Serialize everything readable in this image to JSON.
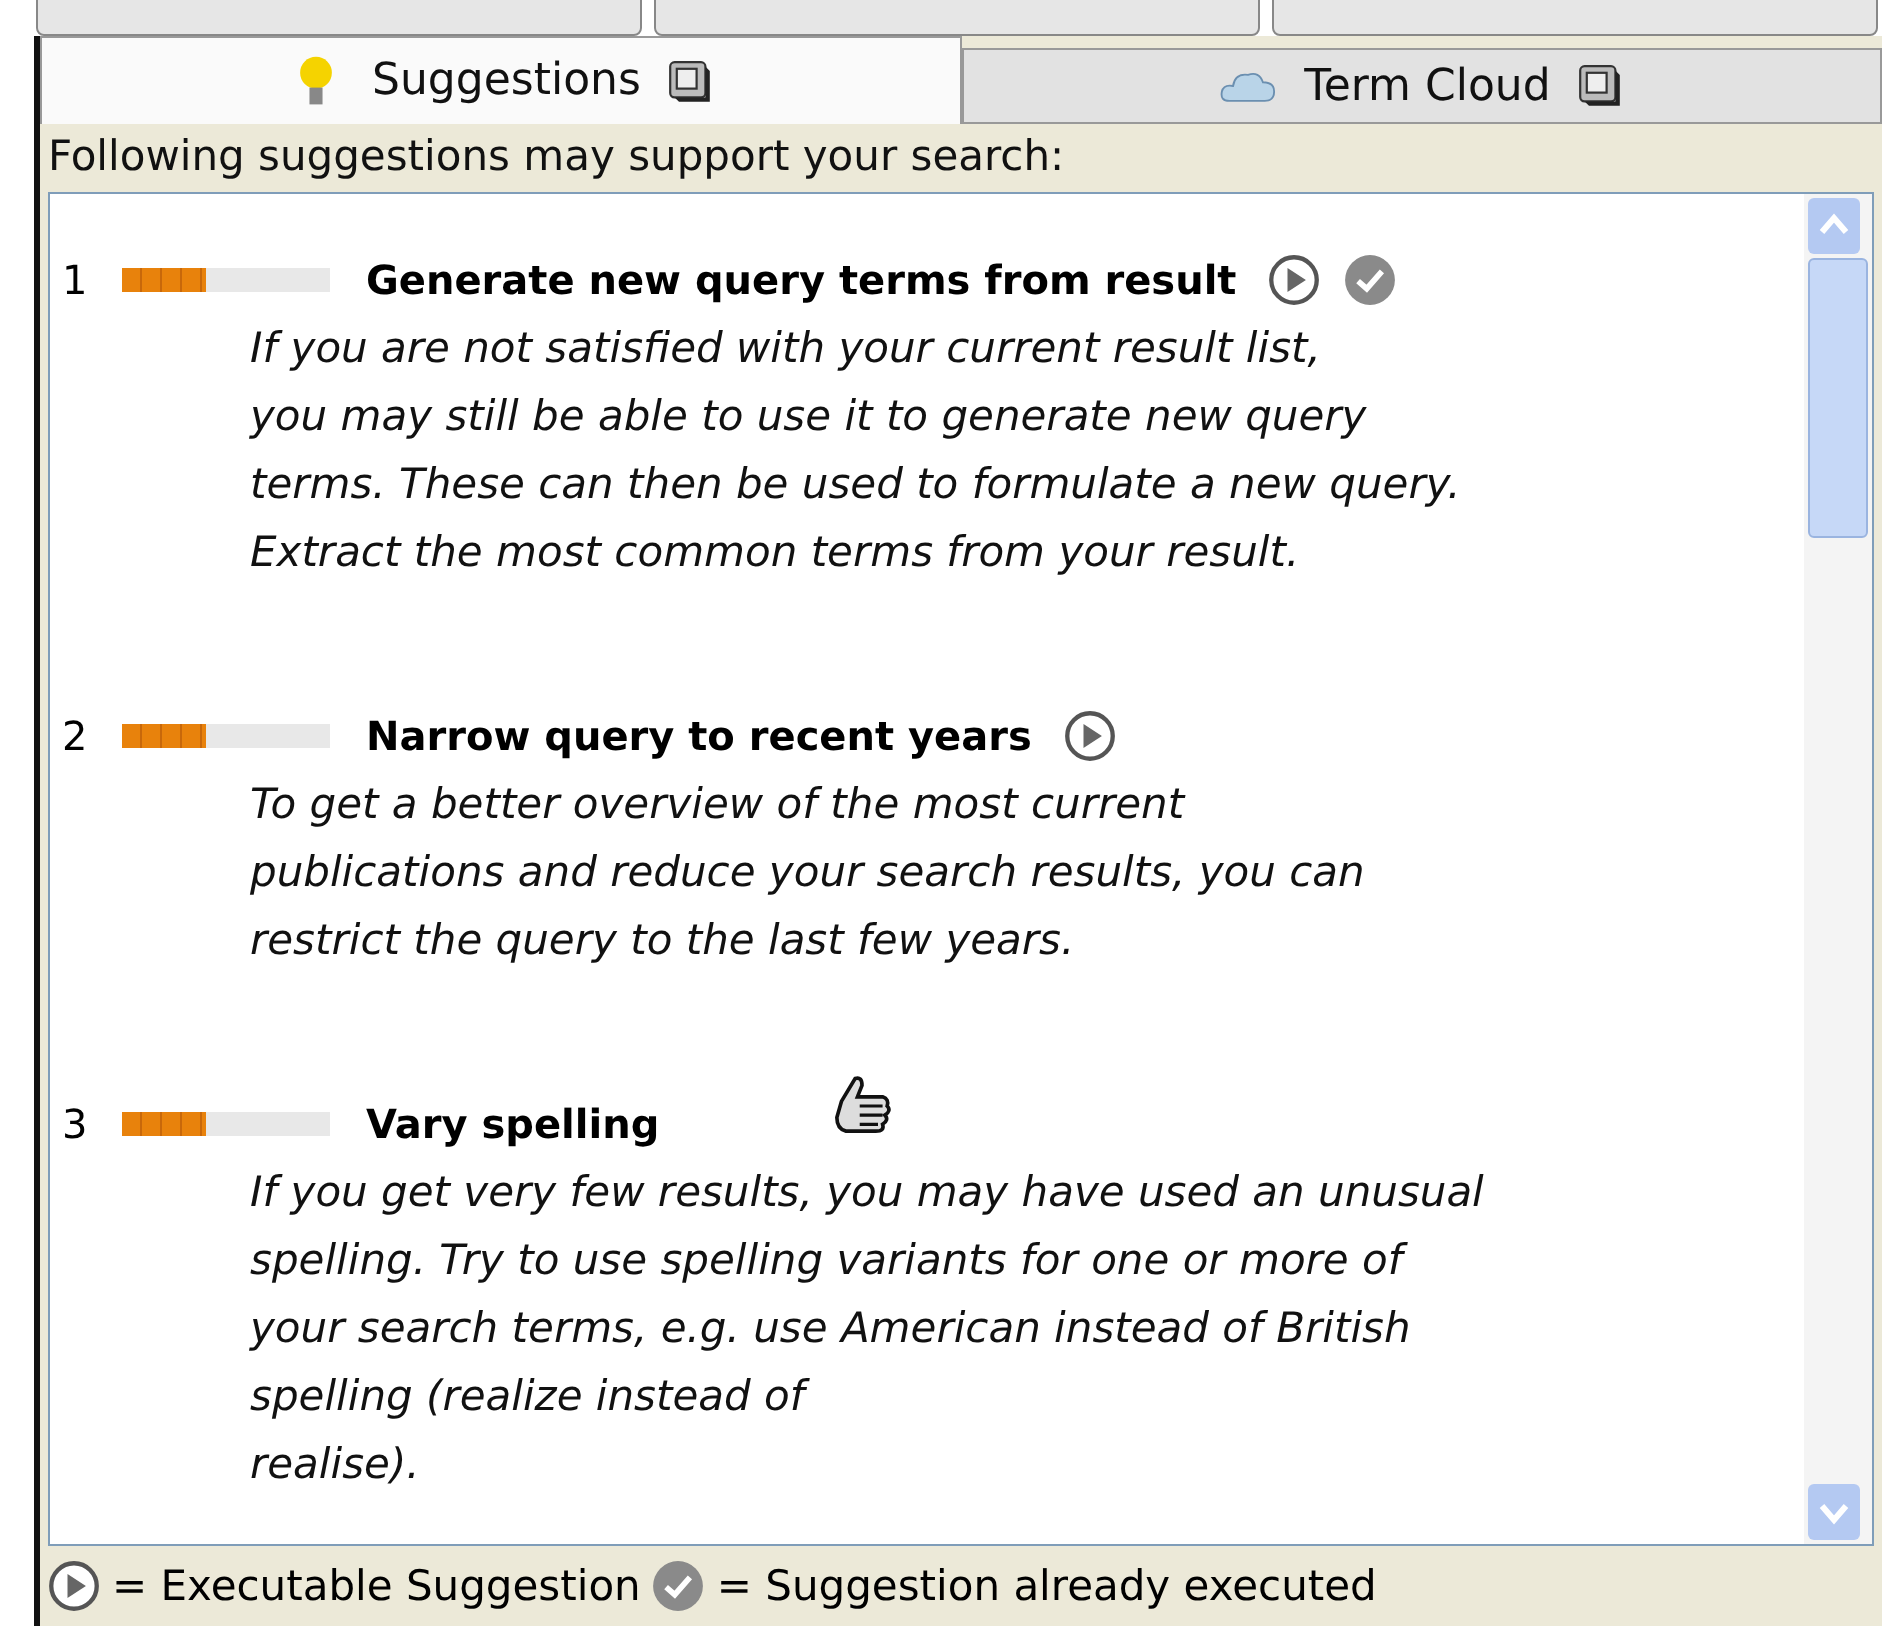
{
  "tabs": [
    {
      "label": "Suggestions",
      "selected": true
    },
    {
      "label": "Term Cloud",
      "selected": false
    }
  ],
  "intro": "Following suggestions may support your search:",
  "suggestions": [
    {
      "number": "1",
      "level": 0.4,
      "title": "Generate new query terms from result",
      "executable": true,
      "executed": true,
      "description": [
        "If you are not satisfied with your current result list,",
        "you may still be able to use it to generate new query",
        "terms. These can then be used to formulate a new query.",
        "Extract the most common terms from your result."
      ]
    },
    {
      "number": "2",
      "level": 0.4,
      "title": "Narrow query to recent years",
      "executable": true,
      "executed": false,
      "description": [
        "To get a better overview of the most current",
        "publications and reduce your search results, you can",
        "restrict the query to the last few years."
      ]
    },
    {
      "number": "3",
      "level": 0.4,
      "title": "Vary spelling",
      "executable": false,
      "executed": false,
      "description": [
        "If you get very few results, you may have used an unusual",
        "spelling. Try to use spelling variants for one or more of",
        "your search terms, e.g. use American instead of British",
        "spelling (realize instead of",
        "realise)."
      ]
    }
  ],
  "legend": {
    "executable": "= Executable Suggestion",
    "executed": "= Suggestion already executed"
  }
}
